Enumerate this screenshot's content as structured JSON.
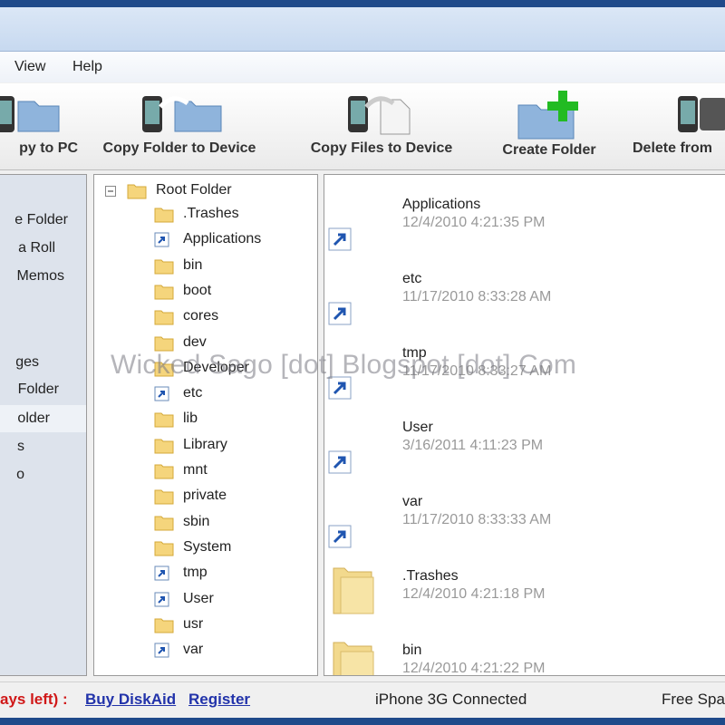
{
  "menu": {
    "items": [
      "View",
      "Help"
    ]
  },
  "toolbar": {
    "buttons": [
      "py to PC",
      "Copy Folder to Device",
      "Copy Files to Device",
      "Create Folder",
      "Delete from"
    ]
  },
  "left_nav": {
    "items": [
      "e Folder",
      "a Roll",
      "Memos",
      "",
      "ges",
      "Folder",
      "older",
      "s",
      "o"
    ]
  },
  "tree": {
    "root": "Root Folder",
    "items": [
      ".Trashes",
      "Applications",
      "bin",
      "boot",
      "cores",
      "dev",
      "Developer",
      "etc",
      "lib",
      "Library",
      "mnt",
      "private",
      "sbin",
      "System",
      "tmp",
      "User",
      "usr",
      "var"
    ]
  },
  "list": {
    "items": [
      {
        "name": "Applications",
        "date": "12/4/2010 4:21:35 PM",
        "icon": "shortcut-icon"
      },
      {
        "name": "etc",
        "date": "11/17/2010 8:33:28 AM",
        "icon": "shortcut-icon"
      },
      {
        "name": "tmp",
        "date": "11/17/2010 8:33:27 AM",
        "icon": "shortcut-icon"
      },
      {
        "name": "User",
        "date": "3/16/2011 4:11:23 PM",
        "icon": "shortcut-icon"
      },
      {
        "name": "var",
        "date": "11/17/2010 8:33:33 AM",
        "icon": "shortcut-icon"
      },
      {
        "name": ".Trashes",
        "date": "12/4/2010 4:21:18 PM",
        "icon": "folder-icon"
      },
      {
        "name": "bin",
        "date": "12/4/2010 4:21:22 PM",
        "icon": "folder-icon"
      }
    ]
  },
  "status": {
    "trial": "ays left) :",
    "buy": "Buy DiskAid",
    "register": "Register",
    "connection": "iPhone 3G Connected",
    "free_space": "Free Spa"
  },
  "watermark": "Wicked Sago [dot] Blogspot [dot] Com",
  "colors": {
    "accent": "#1f4a8a",
    "trial_red": "#d01818",
    "link_blue": "#2233aa"
  }
}
